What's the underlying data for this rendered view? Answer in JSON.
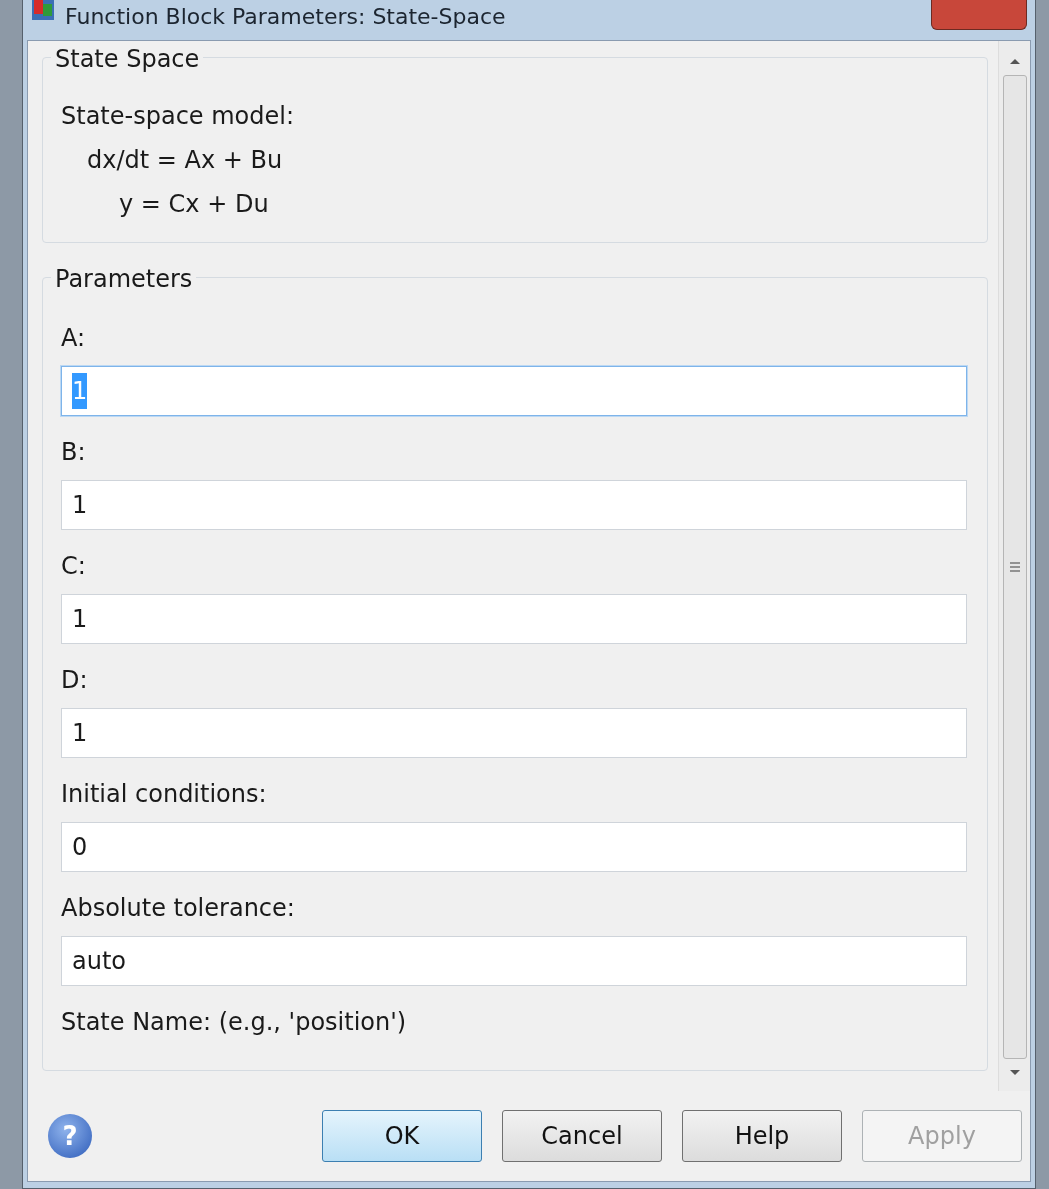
{
  "window": {
    "title": "Function Block Parameters: State-Space"
  },
  "description_group": {
    "title": "State Space",
    "heading": "State-space model:",
    "equations": [
      "dx/dt = Ax + Bu",
      "y = Cx + Du"
    ]
  },
  "parameters_group": {
    "title": "Parameters",
    "fields": [
      {
        "label": "A:",
        "value": "1",
        "focused": true
      },
      {
        "label": "B:",
        "value": "1",
        "focused": false
      },
      {
        "label": "C:",
        "value": "1",
        "focused": false
      },
      {
        "label": "D:",
        "value": "1",
        "focused": false
      },
      {
        "label": "Initial conditions:",
        "value": "0",
        "focused": false
      },
      {
        "label": "Absolute tolerance:",
        "value": "auto",
        "focused": false
      },
      {
        "label": "State Name: (e.g., 'position')"
      }
    ]
  },
  "help_glyph": "?",
  "buttons": [
    {
      "label": "OK",
      "default": true,
      "disabled": false
    },
    {
      "label": "Cancel",
      "default": false,
      "disabled": false
    },
    {
      "label": "Help",
      "default": false,
      "disabled": false
    },
    {
      "label": "Apply",
      "default": false,
      "disabled": true
    }
  ]
}
